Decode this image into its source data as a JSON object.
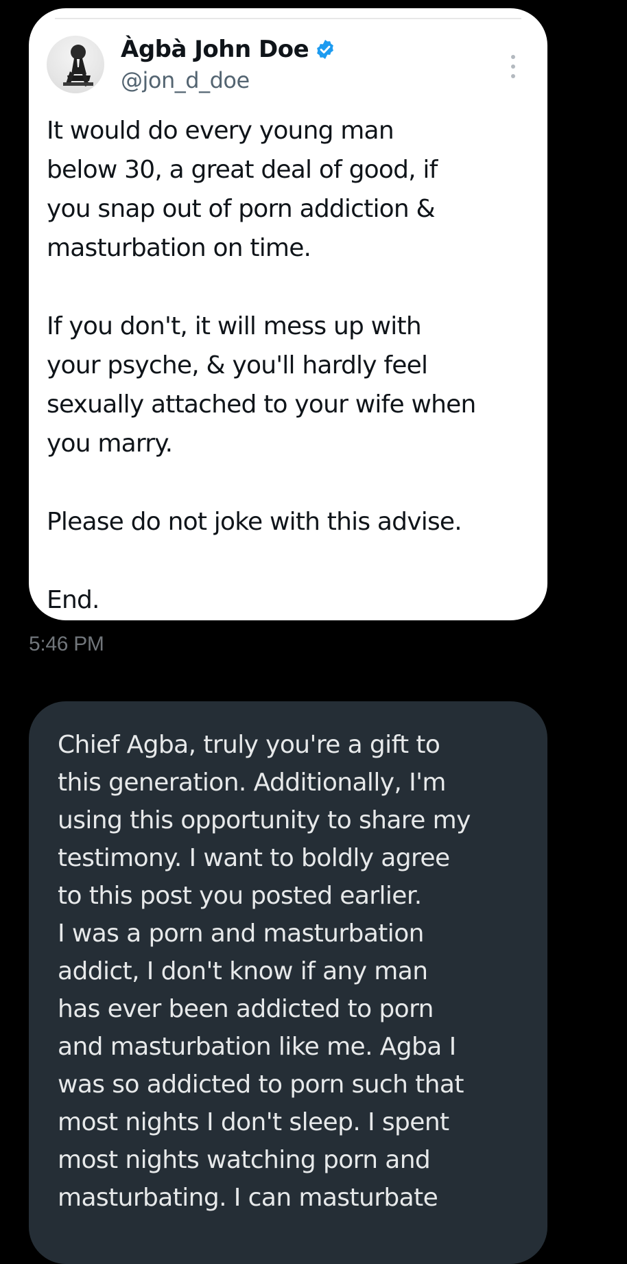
{
  "tweet": {
    "author_name": "Àgbà John Doe",
    "author_handle": "@jon_d_doe",
    "verified_icon": "verified-badge-icon",
    "more_icon": "more-options-icon",
    "body": "It would do every young man\nbelow 30, a great deal of good, if\nyou snap out of porn addiction &\nmasturbation on time.\n\nIf you don't, it will mess up with\nyour psyche, & you'll hardly feel\nsexually attached to your wife when\nyou marry.\n\nPlease do not joke with this advise.\n\nEnd.",
    "timestamp": "5:46 PM"
  },
  "reply": {
    "body": "Chief Agba, truly you're a gift to\nthis generation. Additionally, I'm\nusing this opportunity to share my\ntestimony. I want to boldly agree\nto this post you posted earlier.\nI was a porn and masturbation\naddict, I don't know if any man\nhas ever been addicted to porn\nand masturbation like me. Agba I\nwas so addicted to porn such that\nmost nights I don't sleep. I spent\nmost nights watching porn and\nmasturbating. I can masturbate"
  },
  "colors": {
    "background": "#000000",
    "card_background": "#ffffff",
    "reply_bubble": "#252e36",
    "verified_blue": "#1d9bf0",
    "text_primary": "#0f1419",
    "text_secondary": "#536471",
    "reply_text": "#e7e9ea"
  }
}
